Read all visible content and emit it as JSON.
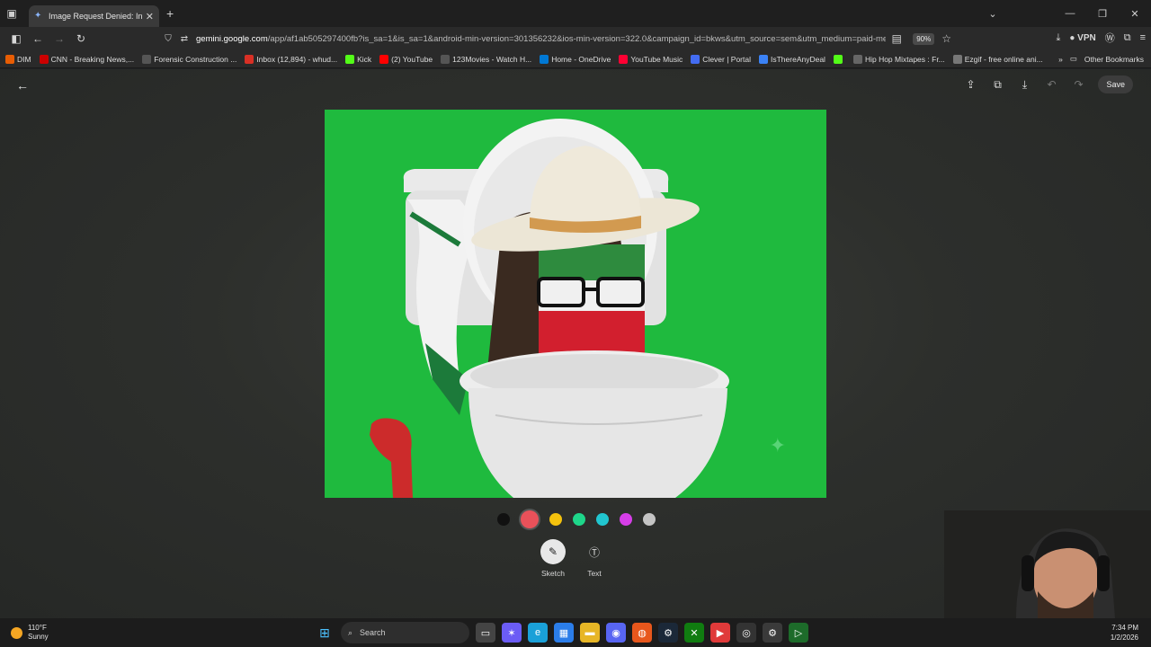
{
  "browser": {
    "tab": {
      "title": "Image Request Denied: Inappro"
    },
    "address": {
      "url_host": "gemini.google.com",
      "url_rest": "/app/af1ab505297400fb?is_sa=1&is_sa=1&android-min-version=301356232&ios-min-version=322.0&campaign_id=bkws&utm_source=sem&utm_medium=paid-media",
      "zoom": "90%",
      "vpn_label": "VPN"
    },
    "bookmarks": [
      {
        "label": "DIM",
        "icon": "orange-square-icon",
        "color": "#e85d04"
      },
      {
        "label": "CNN - Breaking News,...",
        "icon": "cnn-icon",
        "color": "#cc0000"
      },
      {
        "label": "Forensic Construction ...",
        "icon": "globe-icon",
        "color": "#555555"
      },
      {
        "label": "Inbox (12,894) - whud...",
        "icon": "gmail-icon",
        "color": "#d93025"
      },
      {
        "label": "Kick",
        "icon": "kick-icon",
        "color": "#53fc18"
      },
      {
        "label": "(2) YouTube",
        "icon": "youtube-icon",
        "color": "#ff0000"
      },
      {
        "label": "123Movies - Watch H...",
        "icon": "globe-icon",
        "color": "#555555"
      },
      {
        "label": "Home - OneDrive",
        "icon": "onedrive-icon",
        "color": "#0078d4"
      },
      {
        "label": "YouTube Music",
        "icon": "youtube-music-icon",
        "color": "#ff0033"
      },
      {
        "label": "Clever | Portal",
        "icon": "clever-icon",
        "color": "#436cf2"
      },
      {
        "label": "IsThereAnyDeal",
        "icon": "feather-icon",
        "color": "#3b82f6"
      },
      {
        "label": "",
        "icon": "kick-icon",
        "color": "#53fc18"
      },
      {
        "label": "Hip Hop Mixtapes : Fr...",
        "icon": "page-icon",
        "color": "#666666"
      },
      {
        "label": "Ezgif - free online ani...",
        "icon": "ezgif-icon",
        "color": "#777777"
      }
    ],
    "other_bookmarks": "Other Bookmarks"
  },
  "editor": {
    "save_label": "Save",
    "palette": [
      {
        "name": "black",
        "color": "#111111"
      },
      {
        "name": "red",
        "color": "#e8515a"
      },
      {
        "name": "yellow",
        "color": "#f4c20d"
      },
      {
        "name": "green",
        "color": "#1ed68a"
      },
      {
        "name": "teal",
        "color": "#21c6d0"
      },
      {
        "name": "magenta",
        "color": "#d63ee8"
      },
      {
        "name": "gray",
        "color": "#c4c4c4"
      }
    ],
    "selected_color": "red",
    "modes": {
      "sketch": "Sketch",
      "text": "Text"
    },
    "active_mode": "sketch"
  },
  "taskbar": {
    "weather_temp": "110°F",
    "weather_desc": "Sunny",
    "search_label": "Search",
    "time": "7:34 PM",
    "date": "1/2/2026"
  }
}
